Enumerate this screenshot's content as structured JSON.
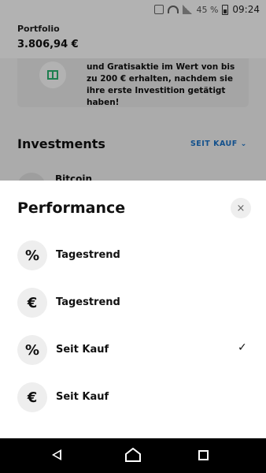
{
  "status_bar": {
    "battery": "45 %",
    "time": "09:24"
  },
  "header": {
    "label": "Portfolio",
    "value": "3.806,94 €"
  },
  "promo": {
    "text": "und Gratisaktie im Wert von bis zu 200 € erhalten, nachdem sie ihre erste Investition getätigt haben!"
  },
  "investments": {
    "title": "Investments",
    "sort_label": "SEIT KAUF",
    "first_item": "Bitcoin"
  },
  "sheet": {
    "title": "Performance",
    "close_symbol": "×",
    "options": [
      {
        "icon": "percent-icon",
        "symbol": "%",
        "label": "Tagestrend",
        "selected": false
      },
      {
        "icon": "euro-icon",
        "symbol": "€",
        "label": "Tagestrend",
        "selected": false
      },
      {
        "icon": "percent-icon",
        "symbol": "%",
        "label": "Seit Kauf",
        "selected": true
      },
      {
        "icon": "euro-icon",
        "symbol": "€",
        "label": "Seit Kauf",
        "selected": false
      }
    ],
    "check_symbol": "✓"
  },
  "colors": {
    "accent": "#1a73c9",
    "gift_green": "#2bb673"
  }
}
